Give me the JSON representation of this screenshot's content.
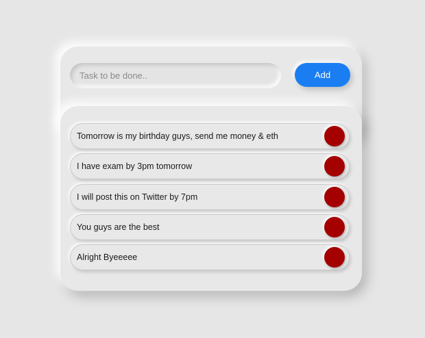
{
  "input": {
    "placeholder": "Task to be done..",
    "value": ""
  },
  "add_button": {
    "label": "Add"
  },
  "tasks": [
    {
      "text": "Tomorrow is my birthday guys, send me money & eth"
    },
    {
      "text": "I have exam by 3pm tomorrow"
    },
    {
      "text": "I will post this on Twitter by 7pm"
    },
    {
      "text": "You guys are the best"
    },
    {
      "text": "Alright Byeeeee"
    }
  ],
  "colors": {
    "accent": "#1a7ef2",
    "delete": "#a40000",
    "background": "#e6e6e6"
  }
}
